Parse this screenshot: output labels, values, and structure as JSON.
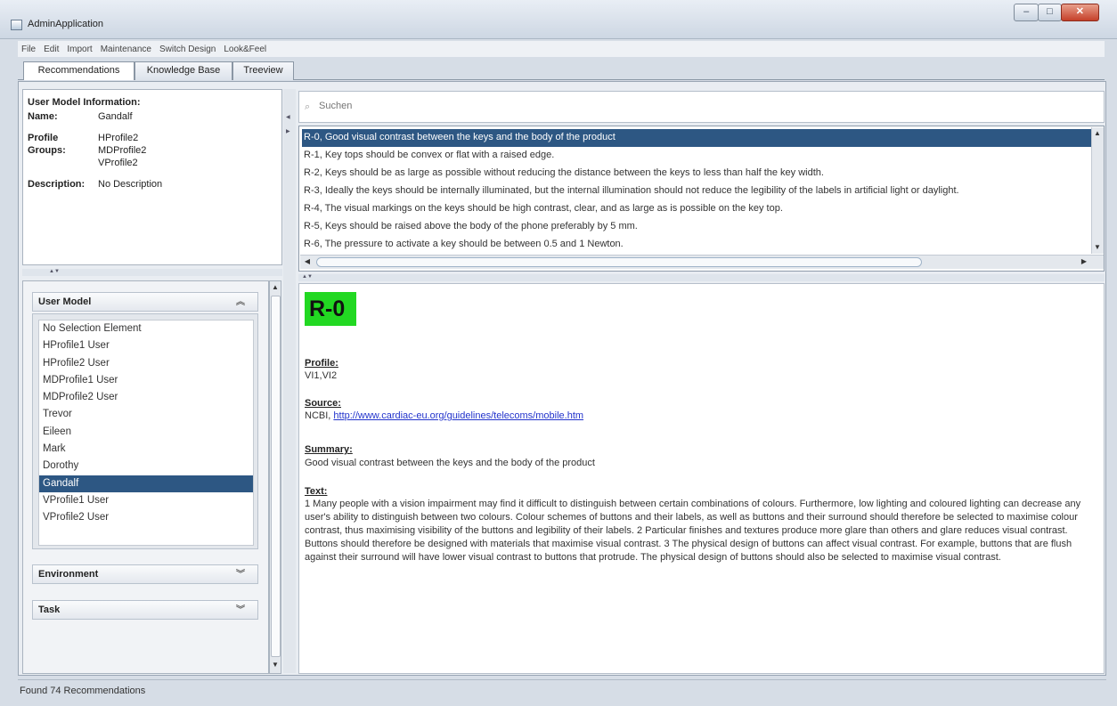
{
  "window": {
    "title": "AdminApplication",
    "minimize": "–",
    "maximize": "□",
    "close": "✕"
  },
  "menu": [
    "File",
    "Edit",
    "Import",
    "Maintenance",
    "Switch Design",
    "Look&Feel"
  ],
  "tabs": [
    "Recommendations",
    "Knowledge Base",
    "Treeview"
  ],
  "user_info": {
    "heading": "User Model Information:",
    "name_label": "Name:",
    "name": "Gandalf",
    "profile_label": "Profile",
    "groups_label": "Groups:",
    "groups": [
      "HProfile2",
      "MDProfile2",
      "VProfile2"
    ],
    "description_label": "Description:",
    "description": "No Description"
  },
  "accordion": {
    "user_model": "User Model",
    "environment": "Environment",
    "task": "Task",
    "users": [
      "No Selection Element",
      "HProfile1 User",
      "HProfile2 User",
      "MDProfile1 User",
      "MDProfile2 User",
      "Trevor",
      "Eileen",
      "Mark",
      "Dorothy",
      "Gandalf",
      "VProfile1 User",
      "VProfile2 User"
    ],
    "selected_user": "Gandalf"
  },
  "search": {
    "placeholder": "Suchen"
  },
  "recommendations": [
    "R-0, Good visual contrast between the keys and the body of the product",
    "R-1, Key tops should be convex or flat with a raised edge.",
    "R-2, Keys should be as large as possible without reducing the distance between the keys to less than half the key width.",
    "R-3, Ideally the keys should be internally illuminated, but the internal illumination should not reduce the legibility of the labels in artificial light or daylight.",
    "R-4, The visual markings on the keys should be high contrast, clear, and as large as is possible on the key top.",
    "R-5, Keys should be raised above the body of the phone preferably by 5 mm.",
    "R-6, The pressure to activate a key should be between 0.5 and 1 Newton."
  ],
  "detail": {
    "id": "R-0",
    "profile_heading": "Profile:",
    "profile": "VI1,VI2",
    "source_heading": "Source:",
    "source_prefix": "NCBI,",
    "source_link": "http://www.cardiac-eu.org/guidelines/telecoms/mobile.htm",
    "summary_heading": "Summary:",
    "summary": "Good visual contrast between the keys and the body of the product",
    "text_heading": "Text:",
    "text": "1 Many people with a vision impairment may find it difficult to distinguish between certain combinations of colours. Furthermore, low lighting and coloured lighting can decrease any user's ability to distinguish between two colours. Colour schemes of buttons and their labels, as well as buttons and their surround should therefore be selected to maximise colour contrast, thus maximising visibility of the buttons and legibility of their labels. 2 Particular finishes and textures produce more glare than others and glare reduces visual contrast. Buttons should therefore be designed with materials that maximise visual contrast. 3 The physical design of buttons can affect visual contrast. For example, buttons that are flush against their surround will have lower visual contrast to buttons that protrude. The physical design of buttons should also be selected to maximise visual contrast."
  },
  "status": "Found 74 Recommendations",
  "colors": {
    "selection": "#2d5783",
    "badge": "#22d822",
    "link": "#2233cc"
  }
}
